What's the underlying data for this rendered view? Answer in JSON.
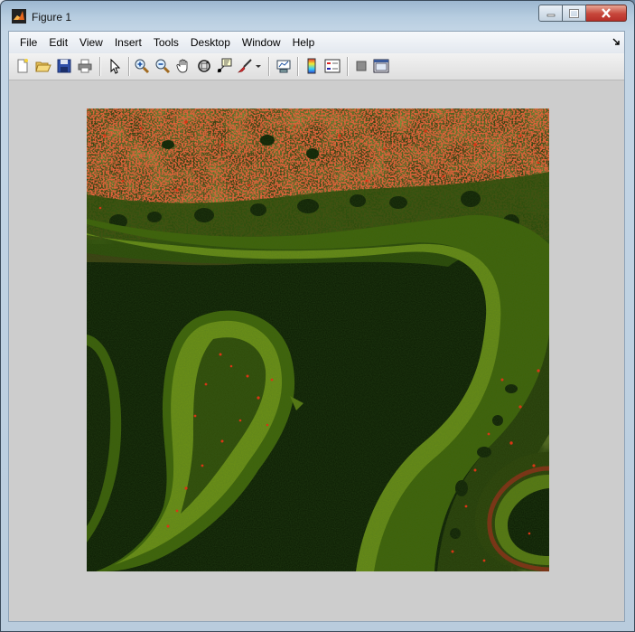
{
  "window": {
    "title": "Figure 1",
    "icons": {
      "app": "matlab-logo-icon",
      "minimize": "minimize-icon",
      "maximize": "maximize-icon",
      "close": "close-icon"
    }
  },
  "menubar": {
    "items": [
      "File",
      "Edit",
      "View",
      "Insert",
      "Tools",
      "Desktop",
      "Window",
      "Help"
    ],
    "dock_icon": "dock-arrow-icon"
  },
  "toolbar": {
    "buttons": [
      "new-figure-icon",
      "open-file-icon",
      "save-figure-icon",
      "print-figure-icon",
      "edit-plot-icon",
      "zoom-in-icon",
      "zoom-out-icon",
      "pan-icon",
      "rotate-3d-icon",
      "data-cursor-icon",
      "brush-icon",
      "brush-dropdown-icon",
      "link-plot-icon",
      "insert-colorbar-icon",
      "insert-legend-icon",
      "hide-plot-tools-icon",
      "show-plot-tools-icon"
    ]
  },
  "figure": {
    "image": "confocal-microscopy-tissue-image",
    "colors": {
      "figure_background": "#cdcdcd",
      "image_background": "#0b1a03",
      "tissue_green": "#5f8a10",
      "signal_red": "#ff2010"
    }
  }
}
